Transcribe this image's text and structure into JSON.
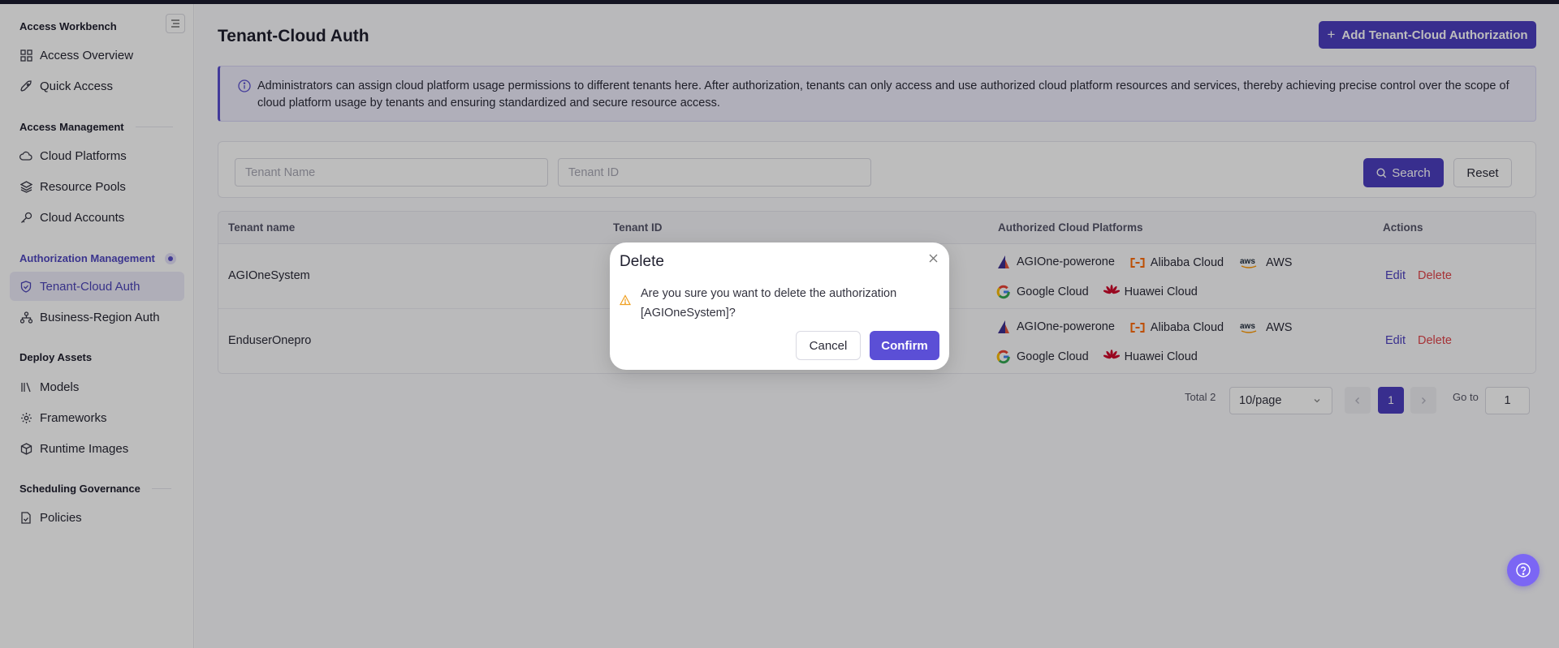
{
  "sidebar": {
    "groups": [
      {
        "label": "Access Workbench"
      },
      {
        "label": "Access Management"
      },
      {
        "label": "Authorization Management"
      },
      {
        "label": "Deploy Assets"
      },
      {
        "label": "Scheduling Governance"
      }
    ],
    "items": [
      {
        "label": "Access Overview",
        "icon": "dashboard-grid-icon"
      },
      {
        "label": "Quick Access",
        "icon": "rocket-icon"
      },
      {
        "label": "Cloud Platforms",
        "icon": "cloud-icon"
      },
      {
        "label": "Resource Pools",
        "icon": "layers-icon"
      },
      {
        "label": "Cloud Accounts",
        "icon": "key-icon"
      },
      {
        "label": "Tenant-Cloud Auth",
        "icon": "shield-check-icon",
        "active": true
      },
      {
        "label": "Business-Region Auth",
        "icon": "hierarchy-icon"
      },
      {
        "label": "Models",
        "icon": "library-icon"
      },
      {
        "label": "Frameworks",
        "icon": "gear-icon"
      },
      {
        "label": "Runtime Images",
        "icon": "package-icon"
      },
      {
        "label": "Policies",
        "icon": "file-check-icon"
      }
    ]
  },
  "header": {
    "title": "Tenant-Cloud Auth",
    "add_button": "Add Tenant-Cloud Authorization"
  },
  "notice": {
    "text": "Administrators can assign cloud platform usage permissions to different tenants here. After authorization, tenants can only access and use authorized cloud platform resources and services, thereby achieving precise control over the scope of cloud platform usage by tenants and ensuring standardized and secure resource access."
  },
  "filters": {
    "tenant_name_placeholder": "Tenant Name",
    "tenant_id_placeholder": "Tenant ID",
    "search_label": "Search",
    "reset_label": "Reset"
  },
  "table": {
    "columns": [
      "Tenant name",
      "Tenant ID",
      "Authorized Cloud Platforms",
      "Actions"
    ],
    "rows": [
      {
        "name": "AGIOneSystem",
        "platforms": [
          "AGIOne-powerone",
          "Alibaba Cloud",
          "AWS",
          "Google Cloud",
          "Huawei Cloud"
        ],
        "edit": "Edit",
        "delete": "Delete"
      },
      {
        "name": "EnduserOnepro",
        "platforms": [
          "AGIOne-powerone",
          "Alibaba Cloud",
          "AWS",
          "Google Cloud",
          "Huawei Cloud"
        ],
        "edit": "Edit",
        "delete": "Delete"
      }
    ]
  },
  "pagination": {
    "total": "Total 2",
    "page_size": "10/page",
    "current_page": "1",
    "goto_label": "Go to",
    "goto_value": "1"
  },
  "modal": {
    "title": "Delete",
    "message": "Are you sure you want to delete the authorization [AGIOneSystem]?",
    "cancel": "Cancel",
    "confirm": "Confirm"
  },
  "colors": {
    "accent": "#4c3fc0",
    "danger": "#e0444a",
    "warning": "#f0a020",
    "help_button": "#7b66f4"
  }
}
